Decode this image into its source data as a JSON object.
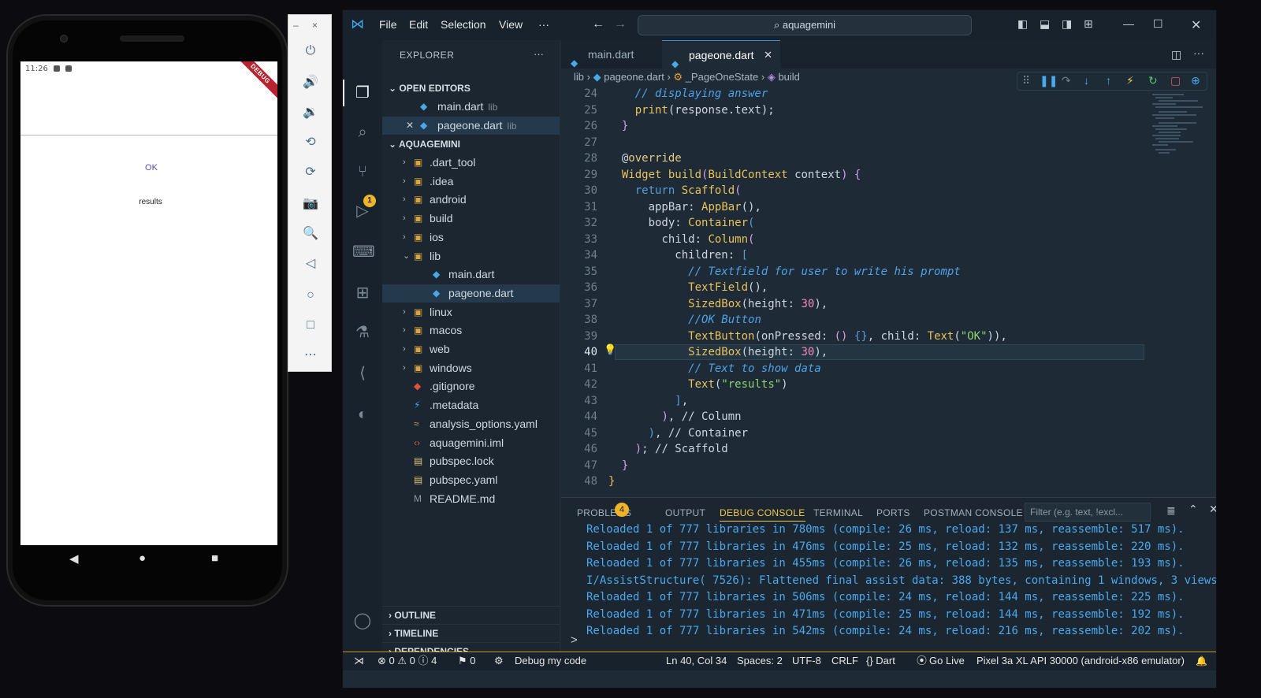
{
  "phone": {
    "status_time": "11:26",
    "debug_ribbon": "DEBUG",
    "ok_button": "OK",
    "results_text": "results",
    "nav": {
      "back": "◀",
      "home": "●",
      "recents": "■"
    }
  },
  "emulator_toolbar": {
    "minimize": "–",
    "close": "×",
    "buttons": [
      "power-icon",
      "volume-up-icon",
      "volume-down-icon",
      "rotate-left-icon",
      "rotate-right-icon",
      "camera-icon",
      "zoom-icon",
      "back-icon",
      "home-icon",
      "overview-icon",
      "more-icon"
    ],
    "glyphs": [
      "⏻",
      "🔊",
      "🔉",
      "⟲",
      "⟳",
      "📷",
      "🔍",
      "◁",
      "○",
      "□",
      "⋯"
    ]
  },
  "titlebar": {
    "menus": [
      "File",
      "Edit",
      "Selection",
      "View",
      "···"
    ],
    "search": "aquagemini"
  },
  "sidebar": {
    "title": "EXPLORER",
    "more": "···",
    "open_editors": "OPEN EDITORS",
    "open_files": [
      {
        "name": "main.dart",
        "path": "lib"
      },
      {
        "name": "pageone.dart",
        "path": "lib"
      }
    ],
    "workspace": "AQUAGEMINI",
    "tree": [
      {
        "name": ".dart_tool",
        "kind": "folder",
        "open": false,
        "depth": 1
      },
      {
        "name": ".idea",
        "kind": "folder",
        "open": false,
        "depth": 1
      },
      {
        "name": "android",
        "kind": "folder",
        "open": false,
        "depth": 1
      },
      {
        "name": "build",
        "kind": "folder",
        "open": false,
        "depth": 1
      },
      {
        "name": "ios",
        "kind": "folder",
        "open": false,
        "depth": 1
      },
      {
        "name": "lib",
        "kind": "folder",
        "open": true,
        "depth": 1
      },
      {
        "name": "main.dart",
        "kind": "dart",
        "depth": 2
      },
      {
        "name": "pageone.dart",
        "kind": "dart",
        "depth": 2,
        "selected": true
      },
      {
        "name": "linux",
        "kind": "folder",
        "open": false,
        "depth": 1
      },
      {
        "name": "macos",
        "kind": "folder",
        "open": false,
        "depth": 1
      },
      {
        "name": "web",
        "kind": "folder",
        "open": false,
        "depth": 1
      },
      {
        "name": "windows",
        "kind": "folder",
        "open": false,
        "depth": 1
      },
      {
        "name": ".gitignore",
        "kind": "git",
        "depth": 1
      },
      {
        "name": ".metadata",
        "kind": "meta",
        "depth": 1
      },
      {
        "name": "analysis_options.yaml",
        "kind": "yaml",
        "depth": 1
      },
      {
        "name": "aquagemini.iml",
        "kind": "iml",
        "depth": 1
      },
      {
        "name": "pubspec.lock",
        "kind": "lock",
        "depth": 1
      },
      {
        "name": "pubspec.yaml",
        "kind": "lock",
        "depth": 1
      },
      {
        "name": "README.md",
        "kind": "md",
        "depth": 1
      }
    ],
    "outline": "OUTLINE",
    "timeline": "TIMELINE",
    "dependencies": "DEPENDENCIES"
  },
  "tabs": [
    {
      "label": "main.dart",
      "active": false
    },
    {
      "label": "pageone.dart",
      "active": true
    }
  ],
  "breadcrumb": [
    "lib",
    "pageone.dart",
    "_PageOneState",
    "build"
  ],
  "editor": {
    "current_line": 40,
    "line_numbers": [
      "24",
      "25",
      "26",
      "27",
      "28",
      "29",
      "30",
      "31",
      "32",
      "33",
      "34",
      "35",
      "36",
      "37",
      "38",
      "39",
      "40",
      "41",
      "42",
      "43",
      "44",
      "45",
      "46",
      "47",
      "48"
    ]
  },
  "panel": {
    "tabs": [
      "PROBLEMS",
      "OUTPUT",
      "DEBUG CONSOLE",
      "TERMINAL",
      "PORTS",
      "POSTMAN CONSOLE"
    ],
    "active_tab": "DEBUG CONSOLE",
    "problems_count": "4",
    "filter_placeholder": "Filter (e.g. text, !excl...",
    "output": [
      "Reloaded 1 of 777 libraries in 780ms (compile: 26 ms, reload: 137 ms, reassemble: 517 ms).",
      "Reloaded 1 of 777 libraries in 476ms (compile: 25 ms, reload: 132 ms, reassemble: 220 ms).",
      "Reloaded 1 of 777 libraries in 455ms (compile: 26 ms, reload: 135 ms, reassemble: 193 ms).",
      "I/AssistStructure( 7526): Flattened final assist data: 388 bytes, containing 1 windows, 3 views",
      "Reloaded 1 of 777 libraries in 506ms (compile: 24 ms, reload: 144 ms, reassemble: 225 ms).",
      "Reloaded 1 of 777 libraries in 471ms (compile: 25 ms, reload: 144 ms, reassemble: 192 ms).",
      "Reloaded 1 of 777 libraries in 542ms (compile: 24 ms, reload: 216 ms, reassemble: 202 ms)."
    ],
    "prompt": ">"
  },
  "statusbar": {
    "remote": "⋊",
    "problems": "⊗ 0 ⚠ 0 ⓘ 4",
    "ports": "⚑ 0",
    "debug": "Debug my code",
    "position": "Ln 40, Col 34",
    "spaces": "Spaces: 2",
    "encoding": "UTF-8",
    "eol": "CRLF",
    "language": "{} Dart",
    "golive": "Go Live",
    "device": "Pixel 3a XL API 30000 (android-x86 emulator)",
    "bell": "🔔"
  }
}
